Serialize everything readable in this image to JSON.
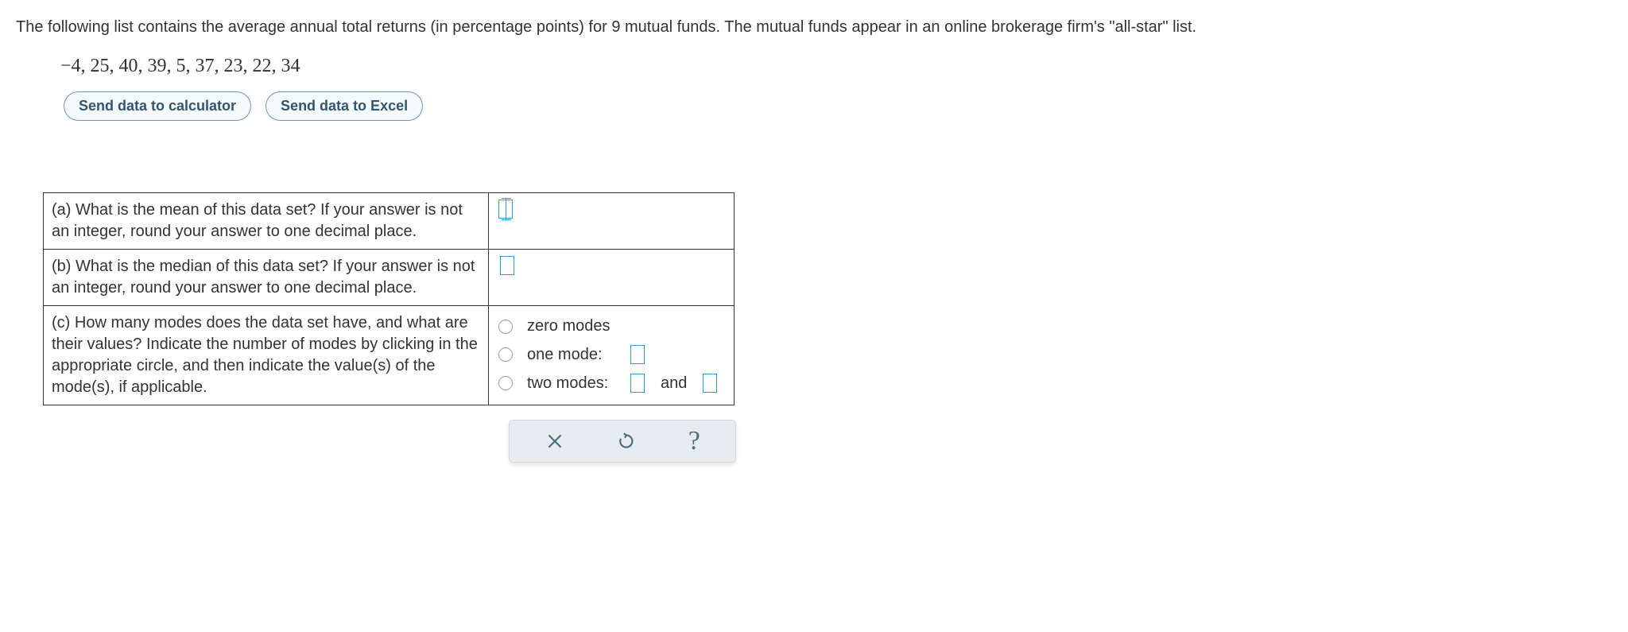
{
  "intro": "The following list contains the average annual total returns (in percentage points) for 9 mutual funds. The mutual funds appear in an online brokerage firm's \"all-star\" list.",
  "dataset": "−4, 25, 40, 39, 5, 37, 23, 22, 34",
  "buttons": {
    "calc": "Send data to calculator",
    "excel": "Send data to Excel"
  },
  "parts": {
    "a": "(a) What is the mean of this data set? If your answer is not an integer, round your answer to one decimal place.",
    "b": "(b) What is the median of this data set? If your answer is not an integer, round your answer to one decimal place.",
    "c": "(c) How many modes does the data set have, and what are their values? Indicate the number of modes by clicking in the appropriate circle, and then indicate the value(s) of the mode(s), if applicable."
  },
  "modes": {
    "zero": "zero modes",
    "one": "one mode:",
    "two": "two modes:",
    "and": "and"
  },
  "actions": {
    "clear": "×",
    "reset": "↺",
    "help": "?"
  }
}
